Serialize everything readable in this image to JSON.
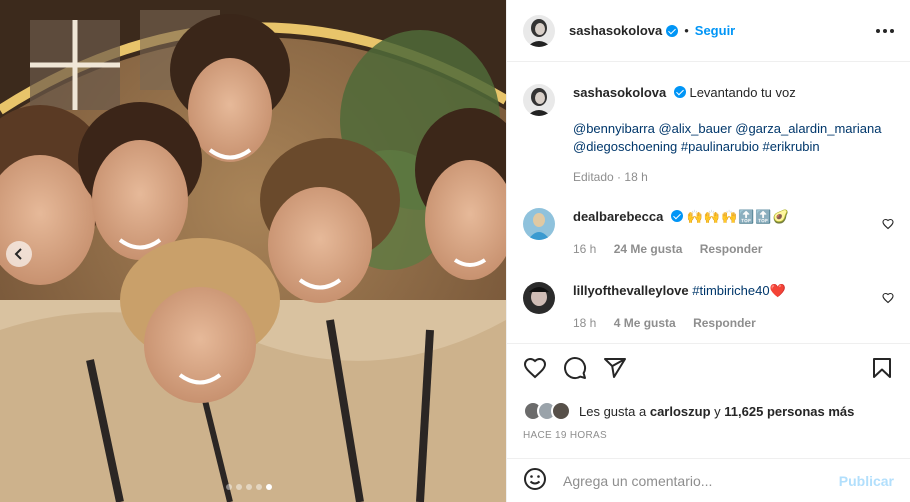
{
  "post": {
    "author": "sashasokolova",
    "follow_label": "Seguir",
    "separator": "•",
    "caption_text": "Levantando tu voz",
    "caption_tags": "@bennyibarra @alix_bauer @garza_alardin_mariana @diegoschoening #paulinarubio #erikrubin",
    "caption_tags_line1": "@bennyibarra @alix_bauer @garza_alardin_mariana",
    "caption_tags_line2": "@diegoschoening #paulinarubio #erikrubin",
    "edited_label": "Editado",
    "caption_time": "18 h"
  },
  "comments": [
    {
      "user": "dealbarebecca",
      "text": "🙌🙌🙌🔝🔝🥑",
      "time": "16 h",
      "likes": "24 Me gusta",
      "reply_label": "Responder"
    },
    {
      "user": "lillyofthevalleylove",
      "text": "#timbiriche40❤️",
      "time": "18 h",
      "likes": "4 Me gusta",
      "reply_label": "Responder"
    }
  ],
  "likes": {
    "prefix": "Les gusta a",
    "user": "carloszup",
    "middle": "y",
    "count": "11,625 personas más"
  },
  "timestamp": "HACE 19 HORAS",
  "composer": {
    "placeholder": "Agrega un comentario...",
    "publish_label": "Publicar"
  },
  "carousel": {
    "total_slides": 5,
    "active_slide": 5
  },
  "colors": {
    "accent": "#0095f6",
    "link": "#00376b",
    "muted": "#8e8e8e",
    "publish_disabled": "#b2dffc"
  }
}
